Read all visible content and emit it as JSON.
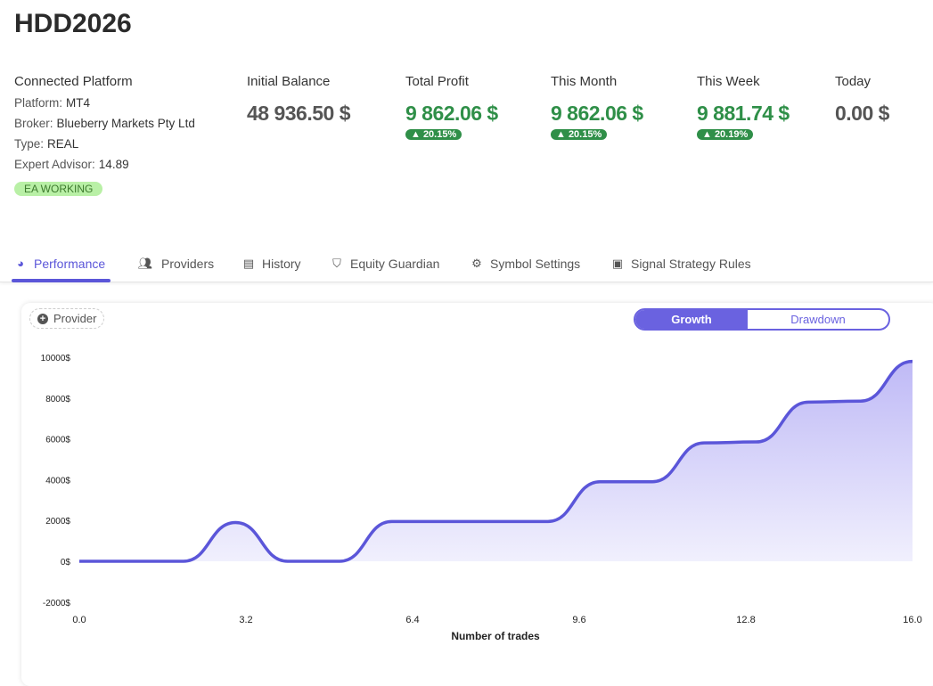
{
  "title": "HDD2026",
  "platform": {
    "heading": "Connected Platform",
    "rows": [
      {
        "label": "Platform:",
        "value": "MT4"
      },
      {
        "label": "Broker:",
        "value": "Blueberry Markets Pty Ltd"
      },
      {
        "label": "Type:",
        "value": "REAL"
      },
      {
        "label": "Expert Advisor:",
        "value": "14.89"
      }
    ],
    "status": "EA WORKING"
  },
  "stats": [
    {
      "label": "Initial Balance",
      "value": "48 936.50 $"
    },
    {
      "label": "Total Profit",
      "value": "9 862.06 $",
      "pct": "▲ 20.15%"
    },
    {
      "label": "This Month",
      "value": "9 862.06 $",
      "pct": "▲ 20.15%"
    },
    {
      "label": "This Week",
      "value": "9 881.74 $",
      "pct": "▲ 20.19%"
    },
    {
      "label": "Today",
      "value": "0.00 $"
    }
  ],
  "tabs": [
    {
      "label": "Performance",
      "icon": "dashboard-icon"
    },
    {
      "label": "Providers",
      "icon": "users-icon"
    },
    {
      "label": "History",
      "icon": "book-icon"
    },
    {
      "label": "Equity Guardian",
      "icon": "shield-icon"
    },
    {
      "label": "Symbol Settings",
      "icon": "gear-icon"
    },
    {
      "label": "Signal Strategy Rules",
      "icon": "toolbox-icon"
    }
  ],
  "provider_button": "Provider",
  "toggle": {
    "growth": "Growth",
    "drawdown": "Drawdown"
  },
  "colors": {
    "accent": "#5b56d9",
    "green": "#2f8f48"
  },
  "chart_data": {
    "type": "area",
    "xlabel": "Number of trades",
    "ylabel": "",
    "xlim": [
      0,
      16
    ],
    "ylim": [
      -2000,
      10000
    ],
    "xticks": [
      "0.0",
      "3.2",
      "6.4",
      "9.6",
      "12.8",
      "16.0"
    ],
    "xtick_values": [
      0,
      3.2,
      6.4,
      9.6,
      12.8,
      16
    ],
    "yticks": [
      "10000$",
      "8000$",
      "6000$",
      "4000$",
      "2000$",
      "0$",
      "-2000$"
    ],
    "ytick_values": [
      10000,
      8000,
      6000,
      4000,
      2000,
      0,
      -2000
    ],
    "x": [
      0,
      1,
      2,
      3,
      4,
      5,
      6,
      7,
      8,
      9,
      10,
      11,
      12,
      13,
      14,
      15,
      16
    ],
    "values": [
      0,
      0,
      0,
      1900,
      0,
      0,
      1950,
      1950,
      1950,
      1950,
      3900,
      3900,
      5800,
      5850,
      7800,
      7850,
      9800
    ]
  }
}
